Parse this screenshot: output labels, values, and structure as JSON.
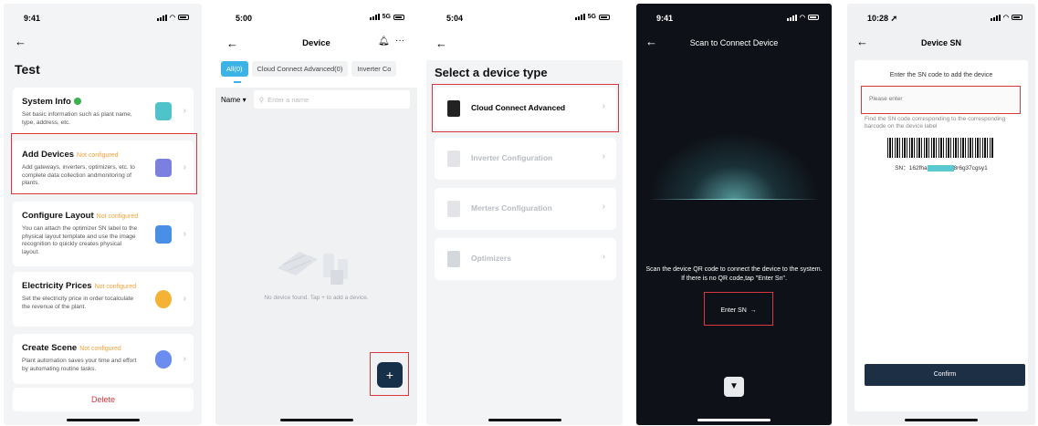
{
  "colors": {
    "highlight": "#d9363e",
    "accent": "#3bb3e6",
    "primary_dark": "#17304a",
    "warning": "#f0a23a"
  },
  "screen1": {
    "time": "9:41",
    "title": "Test",
    "cards": [
      {
        "title": "System Info",
        "badge": "",
        "desc": "Set basic information such as plant name, type, address, etc.",
        "icon": "document-icon",
        "color": "#4fc3c9"
      },
      {
        "title": "Add Devices",
        "badge": "Not configured",
        "desc": "Add gateways, inverters, optimizers, etc. to complete data collection andmonitoring of plants.",
        "icon": "device-box-icon",
        "color": "#7b7fe0"
      },
      {
        "title": "Configure Layout",
        "badge": "Not configured",
        "desc": "You can attach the optimizer SN label to the physical layout template and use the image recognition to quickly creates physical layout.",
        "icon": "layout-grid-icon",
        "color": "#4a8fe7"
      },
      {
        "title": "Electricity Prices",
        "badge": "Not configured",
        "desc": "Set the electricity price in order tocalculate the revenue of the plant.",
        "icon": "coin-icon",
        "color": "#f5b335"
      },
      {
        "title": "Create Scene",
        "badge": "Not configured",
        "desc": "Plant automation saves your time and effort by automating routine tasks.",
        "icon": "cloud-icon",
        "color": "#6b8df0"
      }
    ],
    "delete_label": "Delete"
  },
  "screen2": {
    "time": "5:00",
    "network": "5G",
    "title": "Device",
    "tabs": [
      "All(0)",
      "Cloud Connect Advanced(0)",
      "Inverter Co"
    ],
    "sort_label": "Name",
    "search_placeholder": "Enter a name",
    "empty_text": "No device found. Tap + to add a device.",
    "add_label": "+"
  },
  "screen3": {
    "time": "5:04",
    "network": "5G",
    "title": "Select a device type",
    "types": [
      {
        "label": "Cloud Connect Advanced",
        "icon": "gateway-icon"
      },
      {
        "label": "Inverter Configuration",
        "icon": "inverter-icon"
      },
      {
        "label": "Merters Configuration",
        "icon": "meter-icon"
      },
      {
        "label": "Optimizers",
        "icon": "optimizer-icon"
      }
    ]
  },
  "screen4": {
    "time": "9:41",
    "title": "Scan to Connect Device",
    "instruction": "Scan the device QR code to connect the device to the system.  If there is no QR code,tap \"Enter Sn\".",
    "enter_sn_label": "Enter SN",
    "torch_icon": "flashlight-icon"
  },
  "screen5": {
    "time": "10:28",
    "title": "Device SN",
    "prompt": "Enter the SN code to add the device",
    "input_placeholder": "Please enter",
    "hint": "Find the SN code corresponding to the corresponding barcode on the device label",
    "sn_label": "SN：",
    "sn_prefix": "162fha",
    "sn_masked": "88888888",
    "sn_suffix": "8r6g37cgsy1",
    "confirm_label": "Confirm"
  }
}
